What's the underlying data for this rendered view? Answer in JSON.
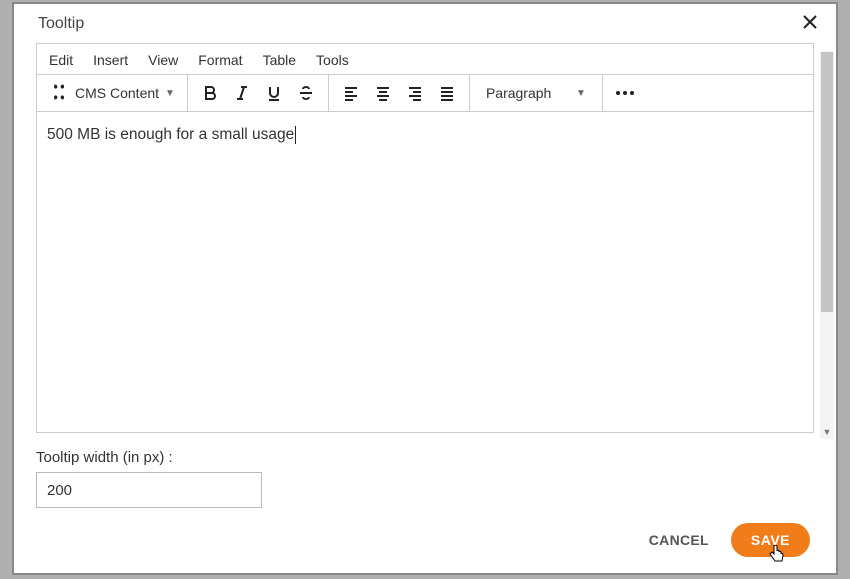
{
  "modal": {
    "title": "Tooltip"
  },
  "menu": {
    "edit": "Edit",
    "insert": "Insert",
    "view": "View",
    "format": "Format",
    "table": "Table",
    "tools": "Tools"
  },
  "toolbar": {
    "cms_label": "CMS Content",
    "paragraph_label": "Paragraph"
  },
  "editor": {
    "content": "500 MB is enough for a small usage"
  },
  "width_field": {
    "label": "Tooltip width (in px) :",
    "value": "200"
  },
  "buttons": {
    "cancel": "CANCEL",
    "save": "SAVE"
  }
}
